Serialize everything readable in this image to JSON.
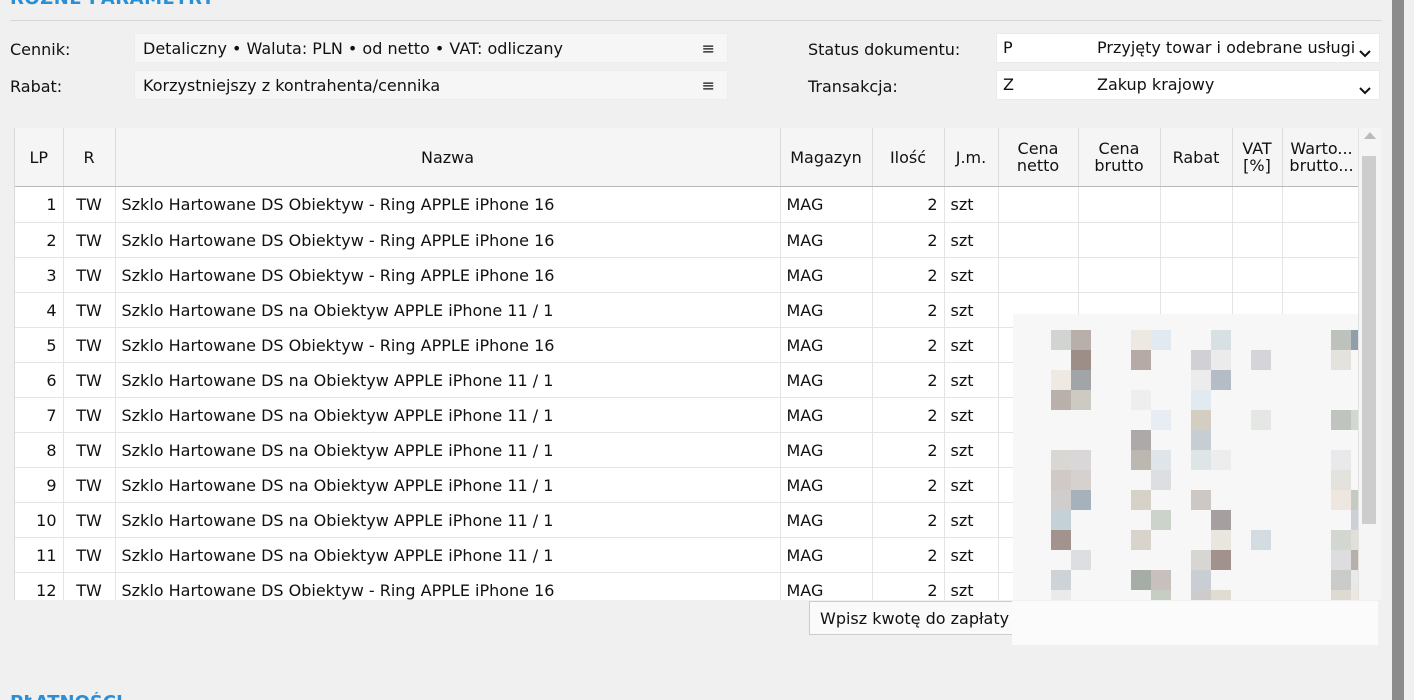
{
  "section": {
    "title": "RÓŻNE PARAMETRY"
  },
  "params": {
    "cennik_label": "Cennik:",
    "cennik_value": "Detaliczny • Waluta: PLN • od netto • VAT: odliczany",
    "rabat_label": "Rabat:",
    "rabat_value": "Korzystniejszy z kontrahenta/cennika",
    "menu_glyph": "≡",
    "status_label": "Status dokumentu:",
    "status_code": "P",
    "status_text": "Przyjęty towar i odebrane usługi",
    "transakcja_label": "Transakcja:",
    "transakcja_code": "Z",
    "transakcja_text": "Zakup krajowy",
    "chevron_glyph": "⌄"
  },
  "table": {
    "headers": {
      "lp": "LP",
      "r": "R",
      "nazwa": "Nazwa",
      "magazyn": "Magazyn",
      "ilosc": "Ilość",
      "jm": "J.m.",
      "cena_netto_1": "Cena",
      "cena_netto_2": "netto",
      "cena_brutto_1": "Cena",
      "cena_brutto_2": "brutto",
      "rabat": "Rabat",
      "vat_1": "VAT",
      "vat_2": "[%]",
      "wartosc_1": "Warto...",
      "wartosc_2": "brutto..."
    },
    "rows": [
      {
        "lp": "1",
        "r": "TW",
        "nazwa": "Szklo Hartowane DS Obiektyw - Ring APPLE iPhone 16",
        "magazyn": "MAG",
        "ilosc": "2",
        "jm": "szt"
      },
      {
        "lp": "2",
        "r": "TW",
        "nazwa": "Szklo Hartowane DS Obiektyw - Ring APPLE iPhone 16",
        "magazyn": "MAG",
        "ilosc": "2",
        "jm": "szt"
      },
      {
        "lp": "3",
        "r": "TW",
        "nazwa": "Szklo Hartowane DS Obiektyw - Ring APPLE iPhone 16",
        "magazyn": "MAG",
        "ilosc": "2",
        "jm": "szt"
      },
      {
        "lp": "4",
        "r": "TW",
        "nazwa": "Szklo Hartowane DS na Obiektyw APPLE iPhone 11 / 1",
        "magazyn": "MAG",
        "ilosc": "2",
        "jm": "szt"
      },
      {
        "lp": "5",
        "r": "TW",
        "nazwa": "Szklo Hartowane DS Obiektyw - Ring APPLE iPhone 16",
        "magazyn": "MAG",
        "ilosc": "2",
        "jm": "szt"
      },
      {
        "lp": "6",
        "r": "TW",
        "nazwa": "Szklo Hartowane DS na Obiektyw APPLE iPhone 11 / 1",
        "magazyn": "MAG",
        "ilosc": "2",
        "jm": "szt"
      },
      {
        "lp": "7",
        "r": "TW",
        "nazwa": "Szklo Hartowane DS na Obiektyw APPLE iPhone 11 / 1",
        "magazyn": "MAG",
        "ilosc": "2",
        "jm": "szt"
      },
      {
        "lp": "8",
        "r": "TW",
        "nazwa": "Szklo Hartowane DS na Obiektyw APPLE iPhone 11 / 1",
        "magazyn": "MAG",
        "ilosc": "2",
        "jm": "szt"
      },
      {
        "lp": "9",
        "r": "TW",
        "nazwa": "Szklo Hartowane DS na Obiektyw APPLE iPhone 11 / 1",
        "magazyn": "MAG",
        "ilosc": "2",
        "jm": "szt"
      },
      {
        "lp": "10",
        "r": "TW",
        "nazwa": "Szklo Hartowane DS na Obiektyw APPLE iPhone 11 / 1",
        "magazyn": "MAG",
        "ilosc": "2",
        "jm": "szt"
      },
      {
        "lp": "11",
        "r": "TW",
        "nazwa": "Szklo Hartowane DS na Obiektyw APPLE iPhone 11 / 1",
        "magazyn": "MAG",
        "ilosc": "2",
        "jm": "szt"
      },
      {
        "lp": "12",
        "r": "TW",
        "nazwa": "Szklo Hartowane DS Obiektyw - Ring APPLE iPhone 16",
        "magazyn": "MAG",
        "ilosc": "2",
        "jm": "szt"
      }
    ]
  },
  "tooltip": {
    "text": "Wpisz kwotę do zapłaty"
  },
  "bottom": {
    "title": "PŁATNOŚCI"
  },
  "colors": {
    "accent": "#2b8fd6"
  }
}
